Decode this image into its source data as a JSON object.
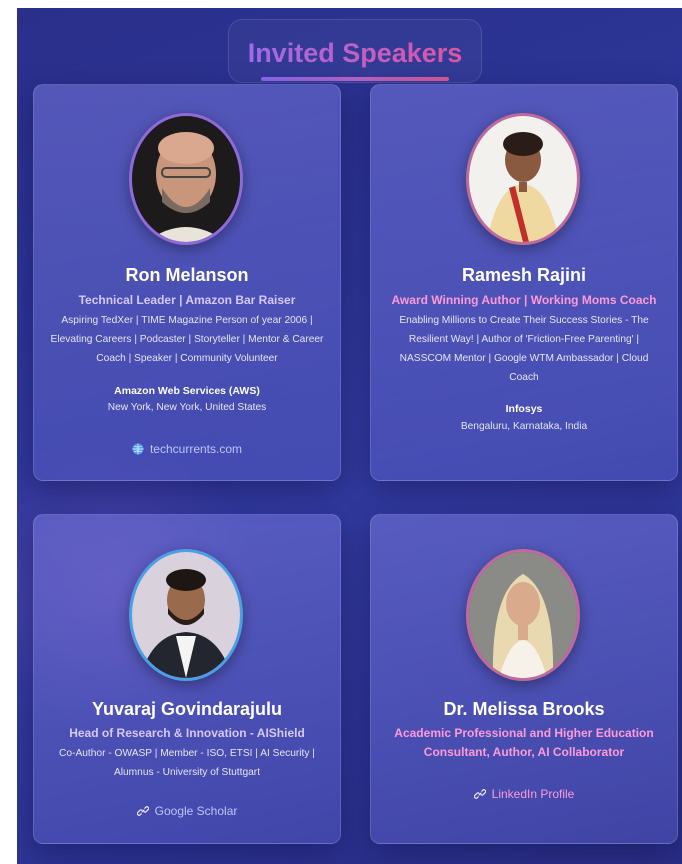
{
  "section": {
    "title": "Invited Speakers"
  },
  "speakers": [
    {
      "name": "Ron Melanson",
      "role": "Technical Leader | Amazon Bar Raiser",
      "description": "Aspiring TedXer | TIME Magazine Person of year 2006 | Elevating Careers | Podcaster | Storyteller | Mentor & Career Coach | Speaker | Community Volunteer",
      "organization": "Amazon Web Services (AWS)",
      "location": "New York, New York, United States",
      "link_label": "techcurrents.com",
      "link_icon": "globe-icon"
    },
    {
      "name": "Ramesh Rajini",
      "role": "Award Winning Author | Working Moms Coach",
      "description": "Enabling Millions to Create Their Success Stories - The Resilient Way! | Author of 'Friction-Free Parenting' | NASSCOM Mentor | Google WTM Ambassador | Cloud Coach",
      "organization": "Infosys",
      "location": "Bengaluru, Karnataka, India"
    },
    {
      "name": "Yuvaraj Govindarajulu",
      "role": "Head of Research & Innovation - AIShield",
      "description": "Co-Author - OWASP | Member - ISO, ETSI | AI Security | Alumnus - University of Stuttgart",
      "link_label": "Google Scholar",
      "link_icon": "link-icon"
    },
    {
      "name": "Dr. Melissa Brooks",
      "role": "Academic Professional and Higher Education Consultant, Author, AI Collaborator",
      "link_label": "LinkedIn Profile",
      "link_icon": "link-icon"
    }
  ]
}
